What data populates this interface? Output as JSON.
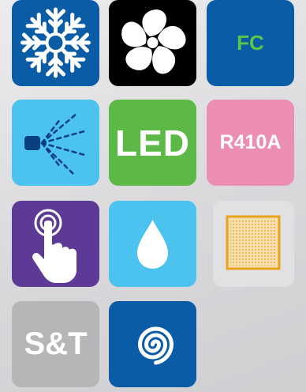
{
  "tiles": [
    {
      "name": "snowflake-icon",
      "bg": "#0b5ca7"
    },
    {
      "name": "fan-icon",
      "bg": "#000000"
    },
    {
      "name": "fc-icon",
      "bg": "#0b5ca7",
      "label": "FC",
      "label_color": "#5cc64a"
    },
    {
      "name": "spray-icon",
      "bg": "#4cc2ee"
    },
    {
      "name": "led-icon",
      "bg": "#5cb946",
      "label": "LED"
    },
    {
      "name": "refrigerant-icon",
      "bg": "#ec8db4",
      "label": "R410A"
    },
    {
      "name": "touch-icon",
      "bg": "#5c3a96"
    },
    {
      "name": "water-drop-icon",
      "bg": "#4cc2ee"
    },
    {
      "name": "filter-icon",
      "bg": "#e1e1e3",
      "accent": "#e8a21c"
    },
    {
      "name": "sleep-timer-icon",
      "bg": "#b6b6b9",
      "label": "S&T"
    },
    {
      "name": "swirl-icon",
      "bg": "#0b5ca7"
    }
  ]
}
